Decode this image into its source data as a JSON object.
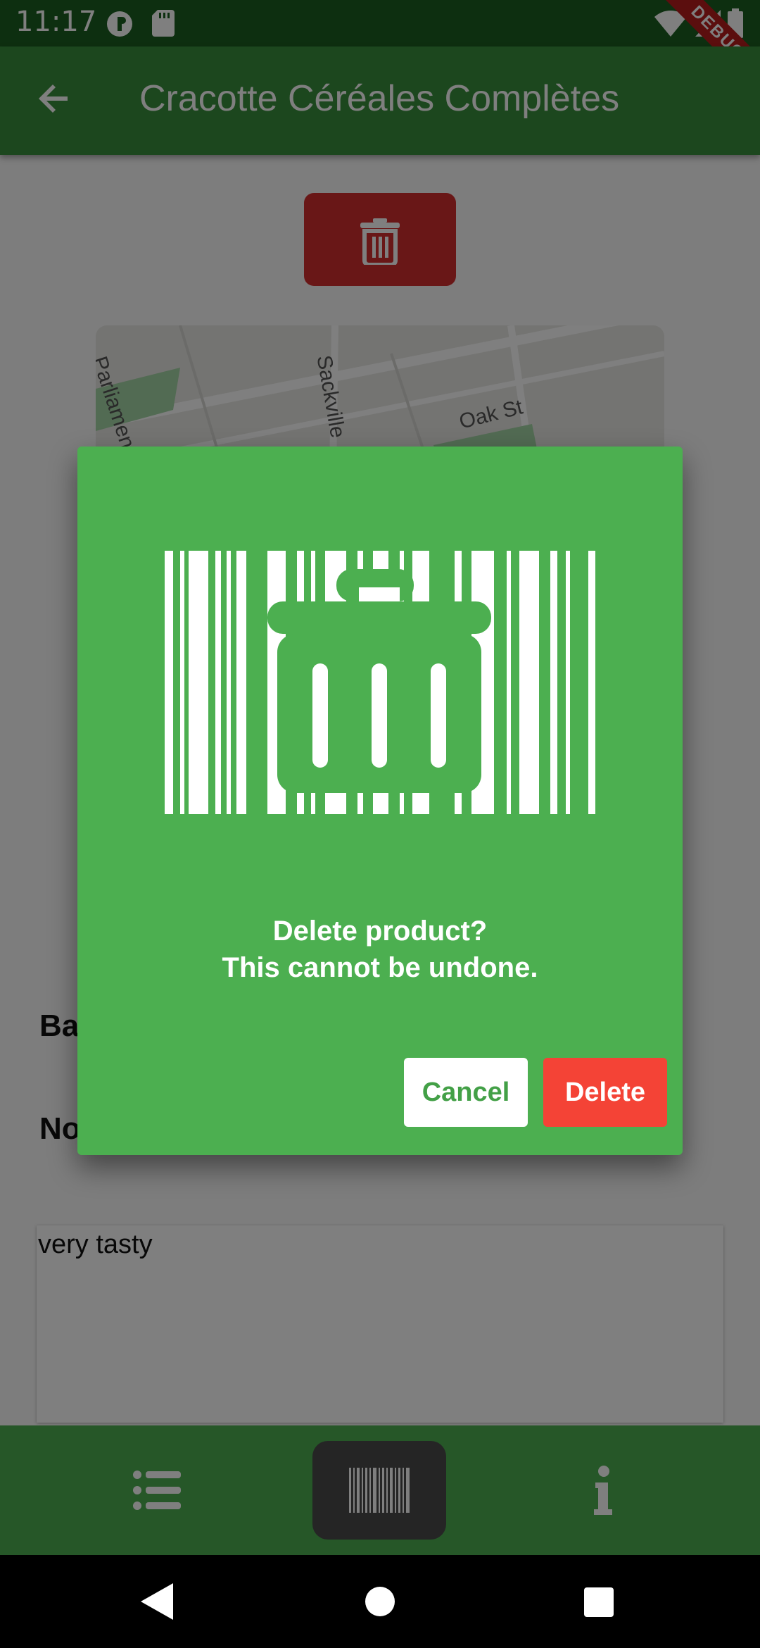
{
  "status_bar": {
    "time": "11:17",
    "debug_label": "DEBUG"
  },
  "app_bar": {
    "title": "Cracotte Céréales Complètes",
    "back_icon": "arrow-left-icon"
  },
  "content": {
    "delete_button_icon": "trash-icon",
    "map_labels": [
      "Parliament",
      "Sackville",
      "Oak St"
    ],
    "fields": [
      "Bar",
      "No"
    ],
    "notes_text": "very tasty"
  },
  "dialog": {
    "illustration": "barcode-trash-icon",
    "message_line1": "Delete product?",
    "message_line2": "This cannot be undone.",
    "cancel_label": "Cancel",
    "delete_label": "Delete"
  },
  "bottom_nav": {
    "items": [
      {
        "icon": "list-icon",
        "active": false
      },
      {
        "icon": "barcode-icon",
        "active": true
      },
      {
        "icon": "info-icon",
        "active": false
      }
    ]
  },
  "colors": {
    "app_bar": "#388e3c",
    "status_bar": "#1b5e20",
    "dialog": "#4caf50",
    "delete_button": "#f44336",
    "cancel_text": "#43a047"
  }
}
